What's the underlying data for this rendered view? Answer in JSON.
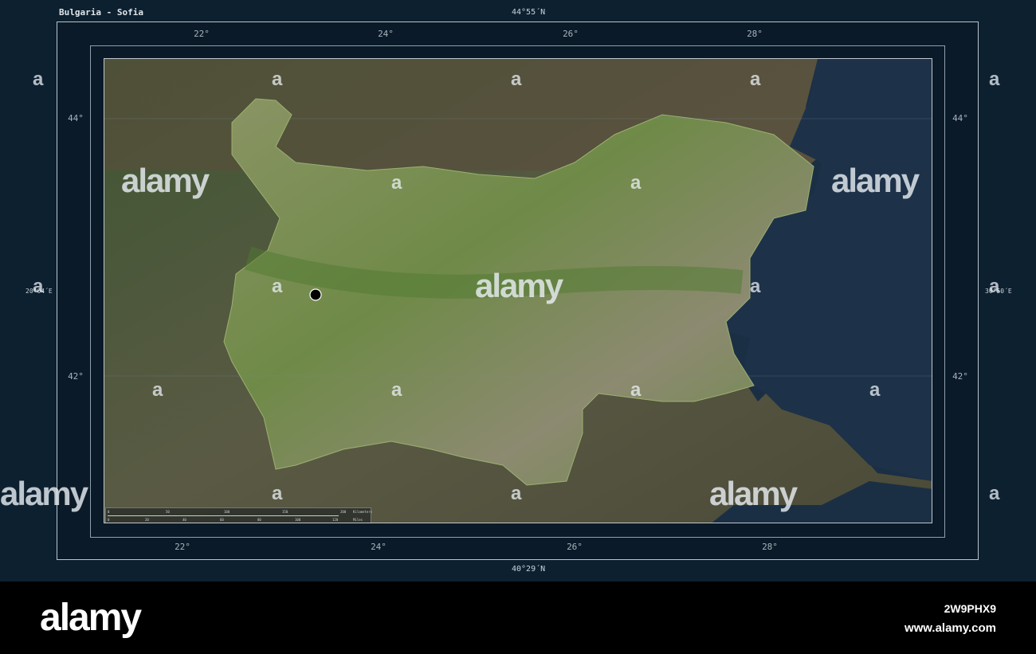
{
  "title": "Bulgaria - Sofia",
  "lat_top": "44°55´N",
  "lat_bottom": "40°29´N",
  "lon_left": "20°04´E",
  "lon_right": "30°50´E",
  "top_lon_ticks": [
    "22°",
    "24°",
    "26°",
    "28°"
  ],
  "bottom_lon_ticks": [
    "22°",
    "24°",
    "26°",
    "28°"
  ],
  "lat_ticks": [
    "44°",
    "42°"
  ],
  "scale": {
    "km_ticks": [
      "0",
      "50",
      "100",
      "150",
      "200"
    ],
    "km_unit": "Kilometers",
    "mi_ticks": [
      "0",
      "20",
      "40",
      "60",
      "80",
      "100",
      "120"
    ],
    "mi_unit": "Miles"
  },
  "marker": "Sofia",
  "watermark": {
    "logo": "alamy",
    "glyph": "a",
    "image_id": "2W9PHX9",
    "site": "www.alamy.com"
  },
  "colors": {
    "sea": "#1b2f44",
    "land": "#4f5a3c",
    "country": "#7c8c58",
    "frame": "#0a1a28"
  }
}
